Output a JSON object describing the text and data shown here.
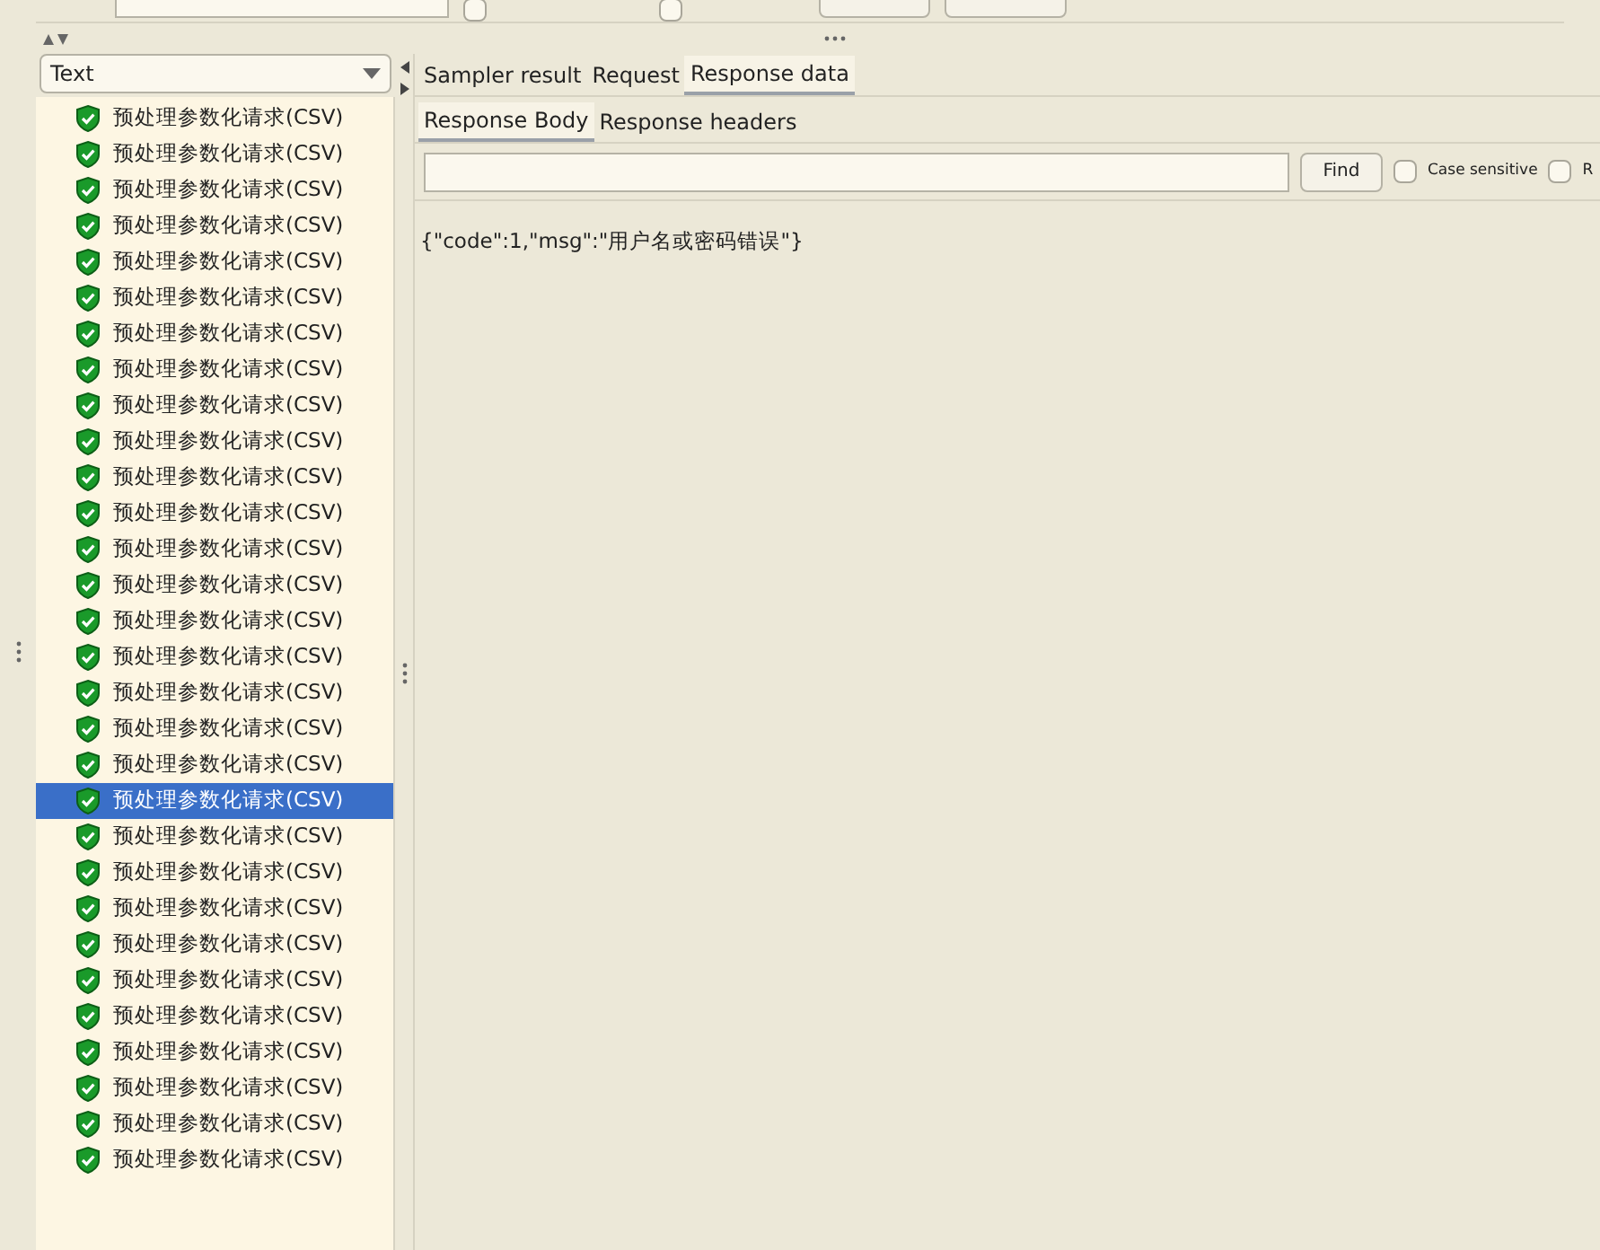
{
  "search_bar": {
    "options": [
      {
        "checked": false
      },
      {
        "checked": false
      }
    ]
  },
  "view_selector": {
    "value": "Text"
  },
  "results": [
    {
      "label": "预处理参数化请求(CSV)",
      "selected": false
    },
    {
      "label": "预处理参数化请求(CSV)",
      "selected": false
    },
    {
      "label": "预处理参数化请求(CSV)",
      "selected": false
    },
    {
      "label": "预处理参数化请求(CSV)",
      "selected": false
    },
    {
      "label": "预处理参数化请求(CSV)",
      "selected": false
    },
    {
      "label": "预处理参数化请求(CSV)",
      "selected": false
    },
    {
      "label": "预处理参数化请求(CSV)",
      "selected": false
    },
    {
      "label": "预处理参数化请求(CSV)",
      "selected": false
    },
    {
      "label": "预处理参数化请求(CSV)",
      "selected": false
    },
    {
      "label": "预处理参数化请求(CSV)",
      "selected": false
    },
    {
      "label": "预处理参数化请求(CSV)",
      "selected": false
    },
    {
      "label": "预处理参数化请求(CSV)",
      "selected": false
    },
    {
      "label": "预处理参数化请求(CSV)",
      "selected": false
    },
    {
      "label": "预处理参数化请求(CSV)",
      "selected": false
    },
    {
      "label": "预处理参数化请求(CSV)",
      "selected": false
    },
    {
      "label": "预处理参数化请求(CSV)",
      "selected": false
    },
    {
      "label": "预处理参数化请求(CSV)",
      "selected": false
    },
    {
      "label": "预处理参数化请求(CSV)",
      "selected": false
    },
    {
      "label": "预处理参数化请求(CSV)",
      "selected": false
    },
    {
      "label": "预处理参数化请求(CSV)",
      "selected": true
    },
    {
      "label": "预处理参数化请求(CSV)",
      "selected": false
    },
    {
      "label": "预处理参数化请求(CSV)",
      "selected": false
    },
    {
      "label": "预处理参数化请求(CSV)",
      "selected": false
    },
    {
      "label": "预处理参数化请求(CSV)",
      "selected": false
    },
    {
      "label": "预处理参数化请求(CSV)",
      "selected": false
    },
    {
      "label": "预处理参数化请求(CSV)",
      "selected": false
    },
    {
      "label": "预处理参数化请求(CSV)",
      "selected": false
    },
    {
      "label": "预处理参数化请求(CSV)",
      "selected": false
    },
    {
      "label": "预处理参数化请求(CSV)",
      "selected": false
    },
    {
      "label": "预处理参数化请求(CSV)",
      "selected": false
    }
  ],
  "tabs": [
    {
      "label": "Sampler result",
      "selected": false
    },
    {
      "label": "Request",
      "selected": false
    },
    {
      "label": "Response data",
      "selected": true
    }
  ],
  "sub_tabs": [
    {
      "label": "Response Body",
      "selected": true
    },
    {
      "label": "Response headers",
      "selected": false
    }
  ],
  "find_bar": {
    "button": "Find",
    "options": [
      {
        "label": "Case sensitive",
        "checked": false
      },
      {
        "label": "R",
        "checked": false
      }
    ]
  },
  "response_body": "{\"code\":1,\"msg\":\"用户名或密码错误\"}"
}
